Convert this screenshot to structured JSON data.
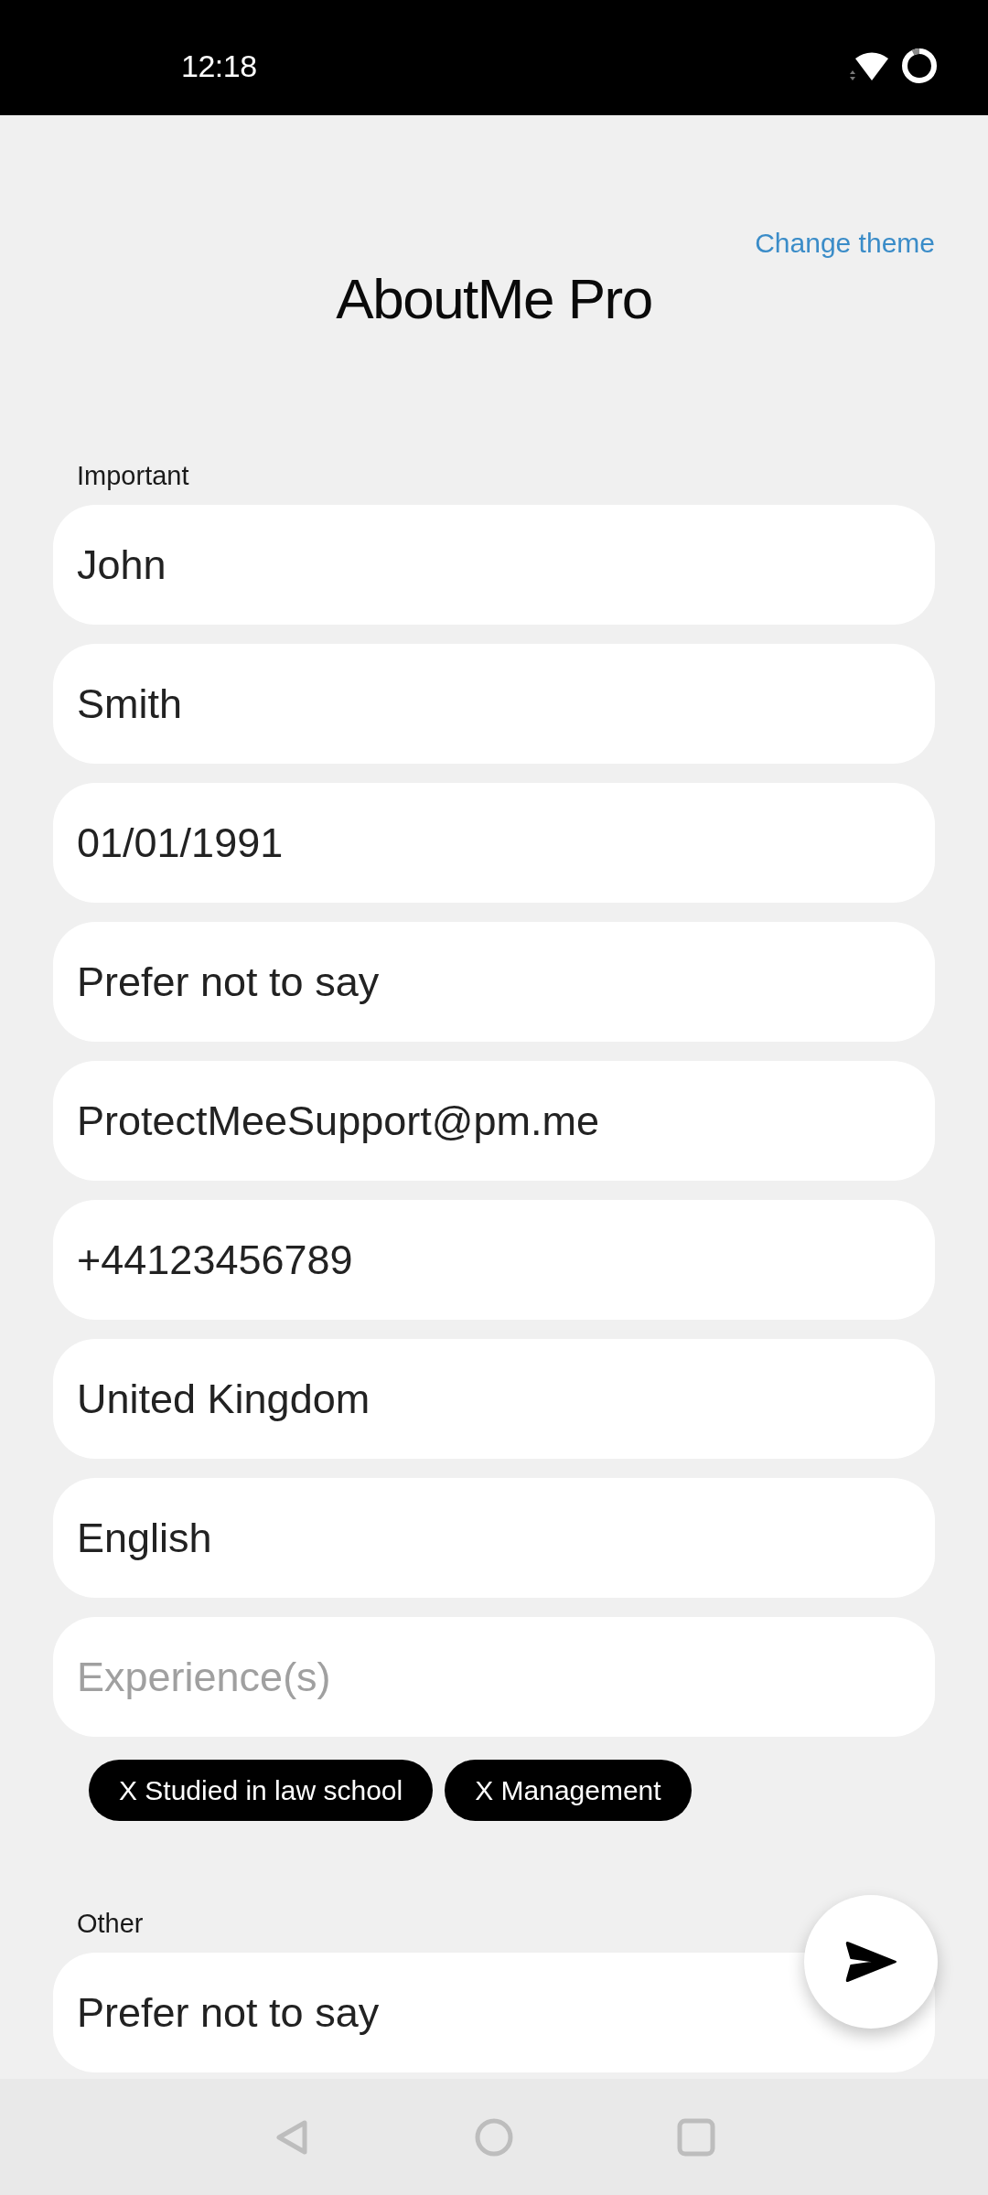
{
  "status_bar": {
    "time": "12:18"
  },
  "header": {
    "link": "Change theme",
    "title": "AboutMe Pro"
  },
  "sections": [
    {
      "label": "Important",
      "fields": [
        {
          "value": "John"
        },
        {
          "value": "Smith"
        },
        {
          "value": "01/01/1991"
        },
        {
          "value": "Prefer not to say"
        },
        {
          "value": "ProtectMeeSupport@pm.me"
        },
        {
          "value": "+44123456789"
        },
        {
          "value": "United Kingdom"
        },
        {
          "value": "English"
        },
        {
          "placeholder": "Experience(s)"
        }
      ],
      "chips": [
        "X Studied in law school",
        "X Management"
      ]
    },
    {
      "label": "Other",
      "fields": [
        {
          "value": "Prefer not to say"
        }
      ]
    }
  ]
}
